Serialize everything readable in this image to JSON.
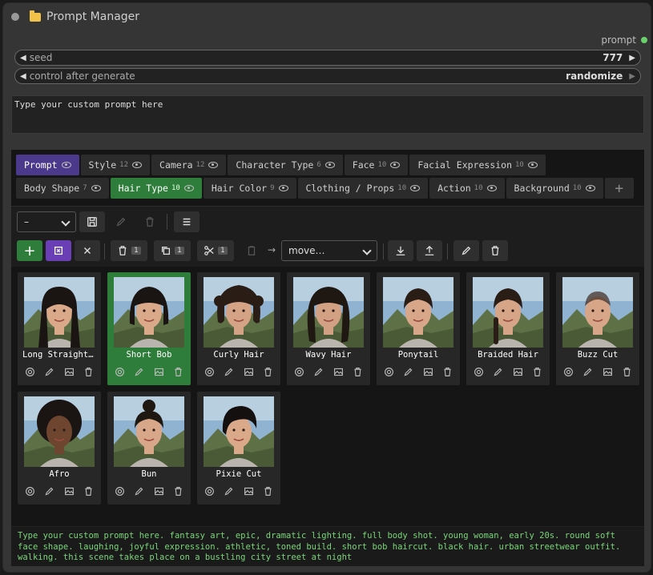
{
  "window": {
    "title": "Prompt Manager",
    "output_label": "prompt"
  },
  "widgets": {
    "seed": {
      "label": "seed",
      "value": "777"
    },
    "control": {
      "label": "control after generate",
      "value": "randomize"
    }
  },
  "prompt_input": {
    "value": "Type your custom prompt here"
  },
  "tabs_row1": [
    {
      "label": "Prompt",
      "count": ""
    },
    {
      "label": "Style",
      "count": "12"
    },
    {
      "label": "Camera",
      "count": "12"
    },
    {
      "label": "Character Type",
      "count": "6"
    },
    {
      "label": "Face",
      "count": "10"
    },
    {
      "label": "Facial Expression",
      "count": "10"
    }
  ],
  "tabs_row2": [
    {
      "label": "Body Shape",
      "count": "7"
    },
    {
      "label": "Hair Type",
      "count": "10"
    },
    {
      "label": "Hair Color",
      "count": "9"
    },
    {
      "label": "Clothing / Props",
      "count": "10"
    },
    {
      "label": "Action",
      "count": "10"
    },
    {
      "label": "Background",
      "count": "10"
    }
  ],
  "toolbar1": {
    "preset_select": "–"
  },
  "toolbar2": {
    "delete_count": "1",
    "copy_count": "1",
    "cut_count": "1",
    "move_select": "move…"
  },
  "cards": [
    {
      "name": "Long Straight Hair",
      "selected": false
    },
    {
      "name": "Short Bob",
      "selected": true
    },
    {
      "name": "Curly Hair",
      "selected": false
    },
    {
      "name": "Wavy Hair",
      "selected": false
    },
    {
      "name": "Ponytail",
      "selected": false
    },
    {
      "name": "Braided Hair",
      "selected": false
    },
    {
      "name": "Buzz Cut",
      "selected": false
    },
    {
      "name": "Afro",
      "selected": false
    },
    {
      "name": "Bun",
      "selected": false
    },
    {
      "name": "Pixie Cut",
      "selected": false
    }
  ],
  "preview": {
    "text": "Type your custom prompt here. fantasy art, epic, dramatic lighting. full body shot. young woman, early 20s. round soft face shape. laughing, joyful expression. athletic, toned build. short bob haircut. black hair. urban streetwear outfit. walking. this scene takes place on a bustling city street at night"
  },
  "colors": {
    "accent_green": "#2e7d3a",
    "accent_purple": "#4b3a8c",
    "preview_text": "#7bd67b"
  }
}
